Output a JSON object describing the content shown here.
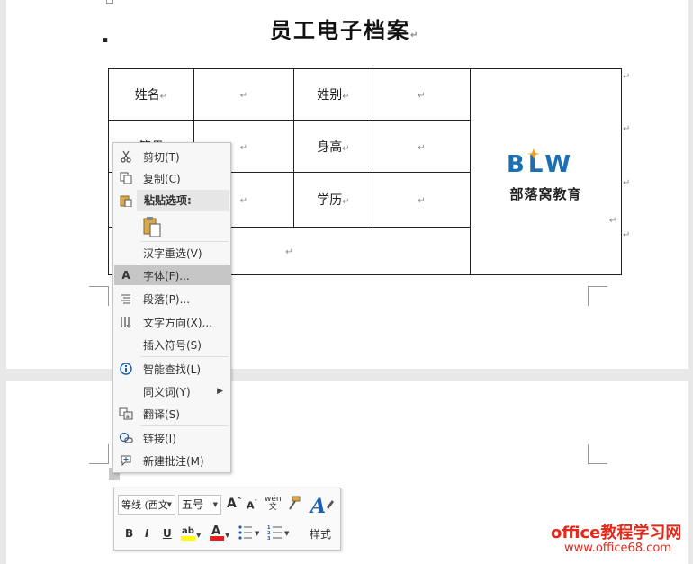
{
  "document": {
    "title": "员工电子档案",
    "para_mark": "↵",
    "form": {
      "labels": {
        "name": "姓名",
        "gender": "姓别",
        "native": "籍贯",
        "height": "身高",
        "education": "学历"
      },
      "logo": {
        "mark": "BLW",
        "text": "部落窝教育"
      }
    }
  },
  "context_menu": {
    "cut": "剪切(T)",
    "copy": "复制(C)",
    "paste_options": "粘贴选项:",
    "reconvert": "汉字重选(V)",
    "font": "字体(F)...",
    "paragraph": "段落(P)...",
    "text_direction": "文字方向(X)...",
    "insert_symbol": "插入符号(S)",
    "smart_lookup": "智能查找(L)",
    "synonyms": "同义词(Y)",
    "translate": "翻译(S)",
    "link": "链接(I)",
    "new_comment": "新建批注(M)"
  },
  "mini_toolbar": {
    "font_family": "等线 (西文",
    "font_size": "五号",
    "bold": "B",
    "italic": "I",
    "underline": "U",
    "styles": "样式",
    "phonetic": "wén"
  },
  "watermark": {
    "line1": "office教程学习网",
    "line2": "www.office68.com"
  },
  "colors": {
    "highlight": "#ffff00",
    "font_color": "#e02020",
    "logo_blue": "#1a6fb5",
    "watermark": "#e5281a"
  }
}
